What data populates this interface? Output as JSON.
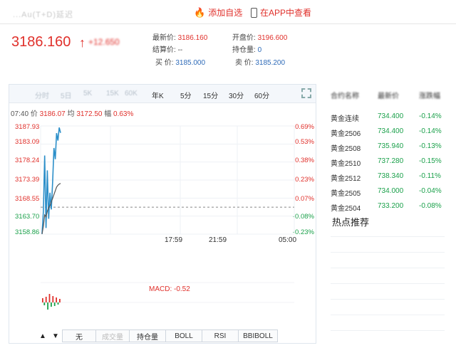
{
  "header": {
    "title_blurred": "...Au(T+D)延迟",
    "add_favorite": "添加自选",
    "app_view": "在APP中查看"
  },
  "price": {
    "last": "3186.160",
    "change_blurred": "+12.650"
  },
  "quote": {
    "latest_label": "最新价:",
    "latest_value": "3186.160",
    "open_label": "开盘价:",
    "open_value": "3196.600",
    "settle_label": "结算价:",
    "settle_value": "--",
    "oi_label": "持仓量:",
    "oi_value": "0",
    "bid_label": "买 价:",
    "bid_value": "3185.000",
    "ask_label": "卖 价:",
    "ask_value": "3185.200"
  },
  "chart_toolbar": {
    "faded_tabs": [
      "分时",
      "5日",
      "5K",
      "15K",
      "60K"
    ],
    "periods": [
      "年K",
      "5分",
      "15分",
      "30分",
      "60分"
    ]
  },
  "chart_info": {
    "time": "07:40",
    "price_label": "价",
    "price": "3186.07",
    "avg_label": "均",
    "avg": "3172.50",
    "range_label": "幅",
    "range": "0.63%"
  },
  "chart_data": {
    "type": "line",
    "left_ticks": [
      "3187.93",
      "3183.09",
      "3178.24",
      "3173.39",
      "3168.55",
      "3163.70",
      "3158.86"
    ],
    "right_ticks": [
      "0.69%",
      "0.53%",
      "0.38%",
      "0.23%",
      "0.07%",
      "-0.08%",
      "-0.23%"
    ],
    "x_ticks": [
      "17:59",
      "21:59",
      "05:00"
    ],
    "ylim": [
      3158.86,
      3187.93
    ],
    "baseline": 3166.1,
    "series": [
      {
        "values": [
          3158.9,
          3165.0,
          3180.0,
          3160.5,
          3176.0,
          3163.0,
          3170.0,
          3165.5,
          3173.0,
          3182.0,
          3179.0,
          3186.0,
          3184.0,
          3187.5,
          3186.07
        ]
      },
      {
        "values": [
          3158.9,
          3161.0,
          3164.0,
          3163.5,
          3165.0,
          3166.0,
          3166.5,
          3167.5,
          3168.5,
          3169.5,
          3170.5,
          3171.5,
          3172.0,
          3172.3,
          3172.5
        ]
      }
    ],
    "macd_label": "MACD: -0.52"
  },
  "indicators": [
    "无",
    "成交量",
    "持仓量",
    "BOLL",
    "RSI",
    "BBIBOLL"
  ],
  "sidebar": {
    "headers": [
      "合约名称",
      "最新价",
      "涨跌幅"
    ],
    "rows": [
      {
        "name": "黄金连续",
        "price": "734.400",
        "change": "-0.14%"
      },
      {
        "name": "黄金2506",
        "price": "734.400",
        "change": "-0.14%"
      },
      {
        "name": "黄金2508",
        "price": "735.940",
        "change": "-0.13%"
      },
      {
        "name": "黄金2510",
        "price": "737.280",
        "change": "-0.15%"
      },
      {
        "name": "黄金2512",
        "price": "738.340",
        "change": "-0.11%"
      },
      {
        "name": "黄金2505",
        "price": "734.000",
        "change": "-0.04%"
      },
      {
        "name": "黄金2504",
        "price": "733.200",
        "change": "-0.08%"
      }
    ],
    "hot_title": "热点推荐"
  },
  "colors": {
    "up": "#e0302b",
    "down": "#1aa04a",
    "line": "#2c8fc9",
    "avg": "#555555",
    "accent_blue": "#2d6ab8"
  }
}
